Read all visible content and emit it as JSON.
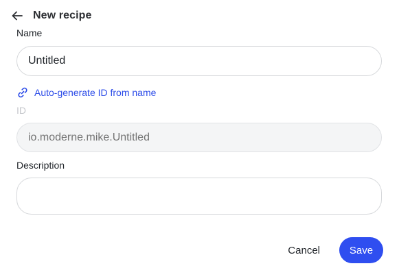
{
  "header": {
    "back_icon": "arrow-left-icon",
    "title": "New recipe"
  },
  "form": {
    "name": {
      "label": "Name",
      "value": "Untitled",
      "placeholder": ""
    },
    "auto_generate": {
      "icon": "link-icon",
      "label": "Auto-generate ID from name"
    },
    "id": {
      "label": "ID",
      "value": "",
      "placeholder": "io.moderne.mike.Untitled",
      "disabled": true
    },
    "description": {
      "label": "Description",
      "value": "",
      "placeholder": ""
    }
  },
  "actions": {
    "cancel_label": "Cancel",
    "save_label": "Save"
  },
  "colors": {
    "accent": "#2f4ef0",
    "link": "#2b4be8",
    "disabled_text": "#b4b7bc",
    "disabled_bg": "#f4f5f6"
  }
}
